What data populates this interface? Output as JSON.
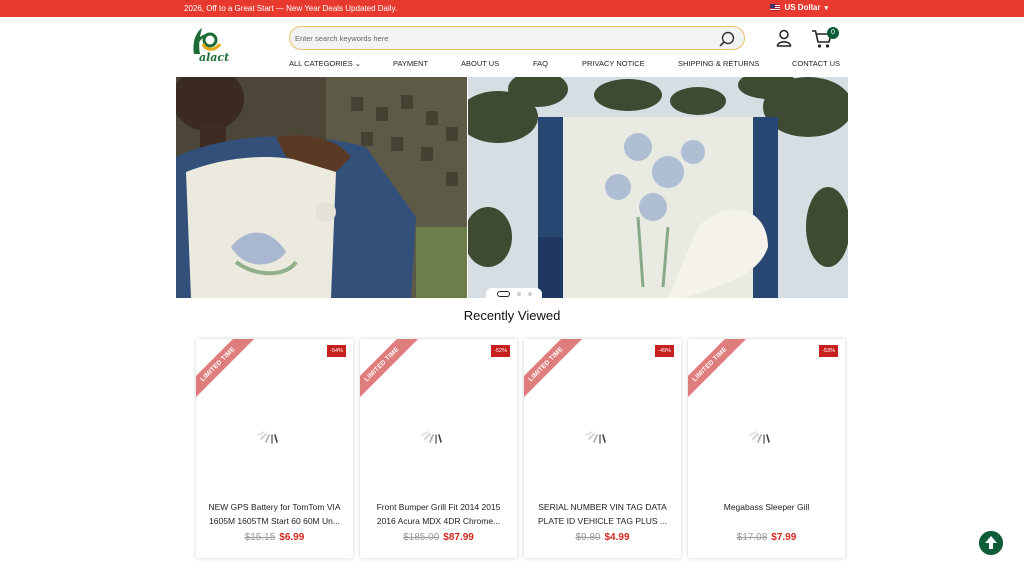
{
  "topbar": {
    "promo": "2026, Off to a Great Start — New Year Deals Updated Daily.",
    "currency": "US Dollar",
    "currency_icon": "us-flag-icon"
  },
  "logo": {
    "text": "alact"
  },
  "search": {
    "placeholder": "Enter search keywords here"
  },
  "cart": {
    "count": "0"
  },
  "nav": {
    "categories": "ALL CATEGORIES",
    "payment": "PAYMENT",
    "about": "ABOUT US",
    "faq": "FAQ",
    "privacy": "PRIVACY NOTICE",
    "shipping": "SHIPPING & RETURNS",
    "contact": "CONTACT US"
  },
  "banner": {
    "slide_count": 3,
    "active_slide": 1
  },
  "section_title": "Recently Viewed",
  "ribbon_text": "LIMITED TIME",
  "products": [
    {
      "discount": "-54%",
      "title_line1": "NEW GPS Battery for TomTom VIA",
      "title_line2": "1605M 1605TM Start 60 60M Un...",
      "old_price": "$15.15",
      "price": "$6.99"
    },
    {
      "discount": "-52%",
      "title_line1": "Front Bumper Grill Fit 2014 2015",
      "title_line2": "2016 Acura MDX 4DR Chrome...",
      "old_price": "$185.00",
      "price": "$87.99"
    },
    {
      "discount": "-49%",
      "title_line1": "SERIAL NUMBER VIN TAG DATA",
      "title_line2": "PLATE ID VEHICLE TAG PLUS ...",
      "old_price": "$9.80",
      "price": "$4.99"
    },
    {
      "discount": "-53%",
      "title_line1": "Megabass Sleeper Gill",
      "title_line2": "",
      "old_price": "$17.08",
      "price": "$7.99"
    }
  ],
  "colors": {
    "topbar": "#e8392f",
    "brand_green": "#0f5c38",
    "sale_red": "#d1281f",
    "ribbon": "#df7c7c"
  }
}
